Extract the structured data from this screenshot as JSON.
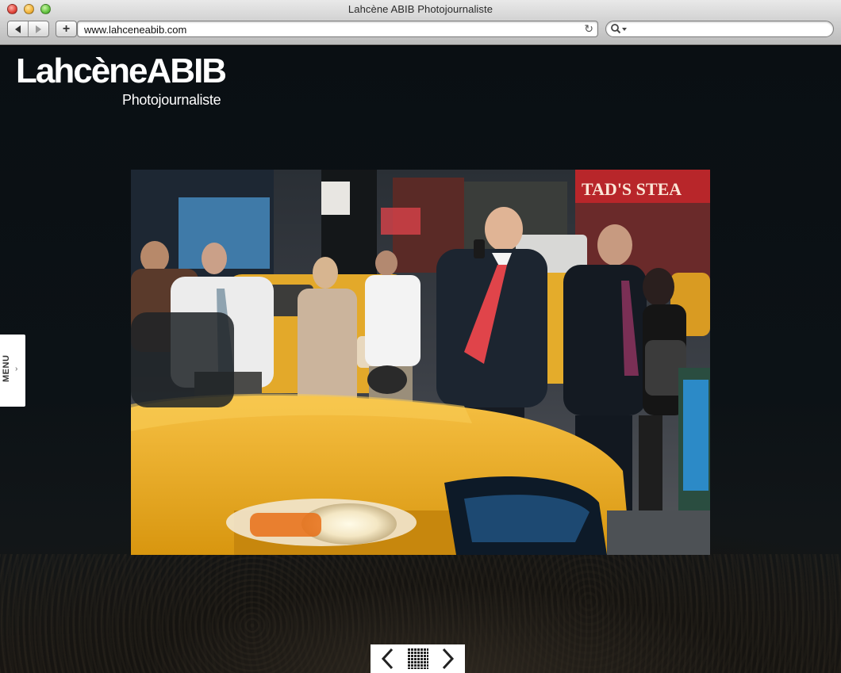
{
  "window": {
    "title": "Lahcène ABIB Photojournaliste"
  },
  "toolbar": {
    "back_icon": "back-arrow-icon",
    "forward_icon": "forward-arrow-icon",
    "add_label": "+",
    "url": "www.lahceneabib.com",
    "reload_icon": "reload-icon",
    "search_placeholder": ""
  },
  "site": {
    "logo_name": "LahcèneABIB",
    "logo_subtitle": "Photojournaliste",
    "menu_label": "MENU",
    "menu_icon": "chevron-right-icon"
  },
  "gallery": {
    "prev_icon": "chevron-left-icon",
    "grid_icon": "grid-icon",
    "next_icon": "chevron-right-icon",
    "storefront_sign": "TAD'S STEA"
  },
  "colors": {
    "page_background": "#0b1014",
    "taxi_yellow": "#f0b21c",
    "tie_red": "#e0444a"
  }
}
